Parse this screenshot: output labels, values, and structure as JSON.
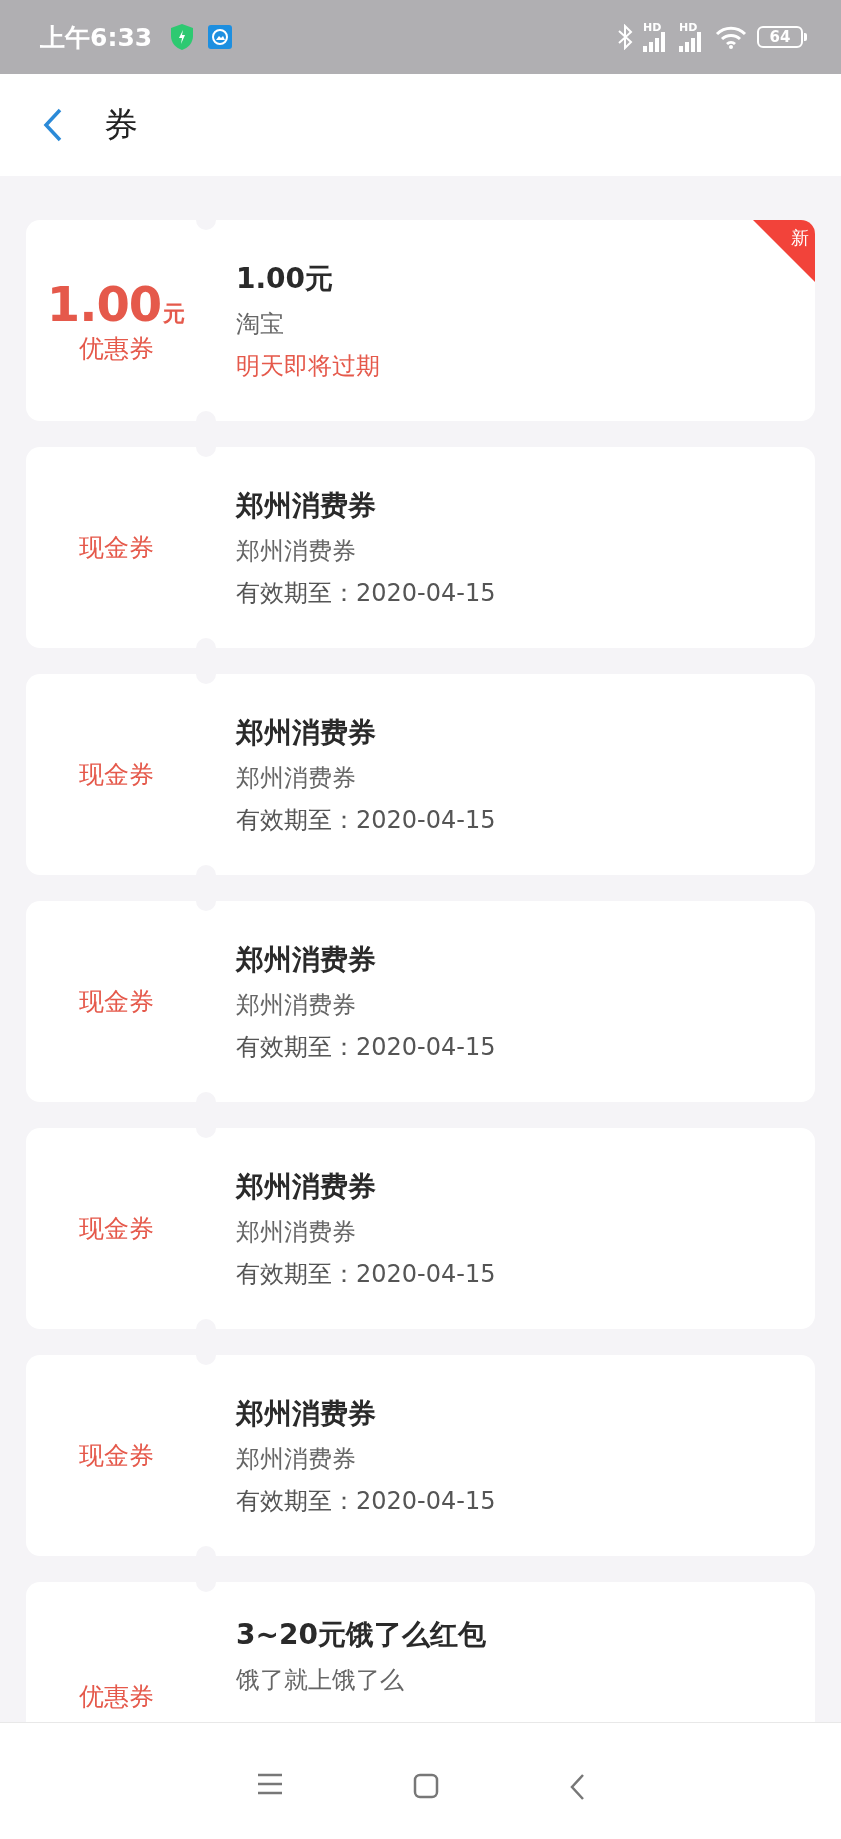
{
  "status_bar": {
    "time": "上午6:33",
    "signal_labels": [
      "HD",
      "HD"
    ],
    "battery": "64"
  },
  "header": {
    "title": "券"
  },
  "coupons": [
    {
      "kind": "amount",
      "amount": "1.00",
      "unit": "元",
      "type_label": "优惠券",
      "title": "1.00元",
      "subtitle": "淘宝",
      "note": "明天即将过期",
      "expiring": true,
      "badge": "新"
    },
    {
      "kind": "label",
      "type_label": "现金券",
      "title": "郑州消费券",
      "subtitle": "郑州消费券",
      "note": "有效期至：2020-04-15",
      "expiring": false
    },
    {
      "kind": "label",
      "type_label": "现金券",
      "title": "郑州消费券",
      "subtitle": "郑州消费券",
      "note": "有效期至：2020-04-15",
      "expiring": false
    },
    {
      "kind": "label",
      "type_label": "现金券",
      "title": "郑州消费券",
      "subtitle": "郑州消费券",
      "note": "有效期至：2020-04-15",
      "expiring": false
    },
    {
      "kind": "label",
      "type_label": "现金券",
      "title": "郑州消费券",
      "subtitle": "郑州消费券",
      "note": "有效期至：2020-04-15",
      "expiring": false
    },
    {
      "kind": "label",
      "type_label": "现金券",
      "title": "郑州消费券",
      "subtitle": "郑州消费券",
      "note": "有效期至：2020-04-15",
      "expiring": false
    },
    {
      "kind": "label",
      "type_label": "优惠券",
      "title": "3~20元饿了么红包",
      "subtitle": "饿了就上饿了么"
    }
  ]
}
